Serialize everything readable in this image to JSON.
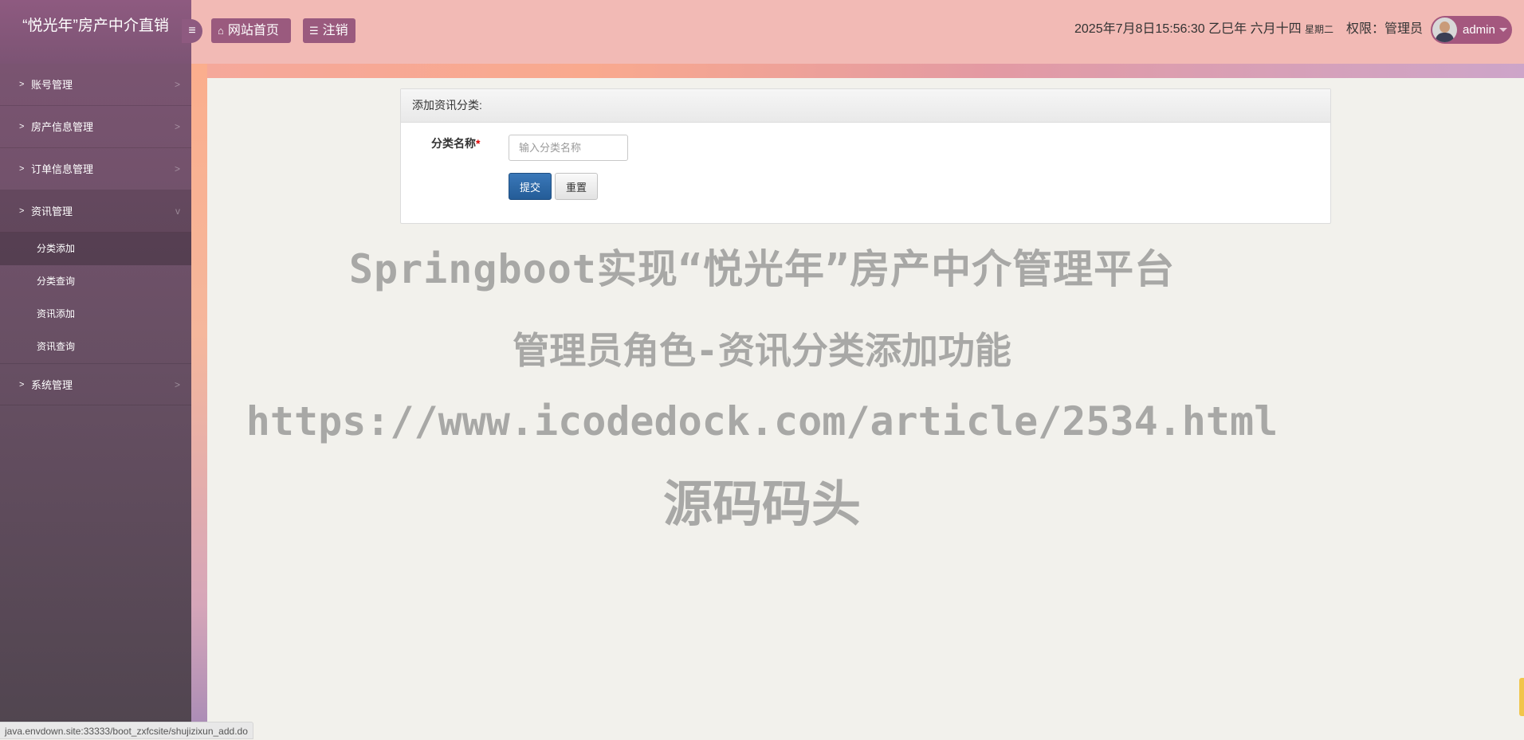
{
  "header": {
    "brand": "“悦光年”房产中介直销",
    "toggle_icon": "≡",
    "home_icon": "⌂",
    "home_label": "网站首页",
    "logout_icon": "☰",
    "logout_label": "注销",
    "datetime": "2025年7月8日15:56:30 乙巳年 六月十四",
    "weekday": "星期二",
    "permission": "权限：管理员",
    "username": "admin"
  },
  "sidebar": {
    "items": [
      {
        "label": "账号管理"
      },
      {
        "label": "房产信息管理"
      },
      {
        "label": "订单信息管理"
      },
      {
        "label": "资讯管理",
        "open": true,
        "children": [
          {
            "label": "分类添加",
            "active": true
          },
          {
            "label": "分类查询"
          },
          {
            "label": "资讯添加"
          },
          {
            "label": "资讯查询"
          }
        ]
      },
      {
        "label": "系统管理"
      }
    ]
  },
  "form": {
    "title": "添加资讯分类:",
    "field_label": "分类名称",
    "required_mark": "*",
    "field_placeholder": "输入分类名称",
    "field_value": "",
    "submit_label": "提交",
    "reset_label": "重置"
  },
  "watermark": {
    "line1": "Springboot实现“悦光年”房产中介管理平台",
    "line2": "管理员角色-资讯分类添加功能",
    "line3": "https://www.icodedock.com/article/2534.html",
    "line4": "源码码头"
  },
  "status": {
    "url": "java.envdown.site:33333/boot_zxfcsite/shujizixun_add.do"
  }
}
